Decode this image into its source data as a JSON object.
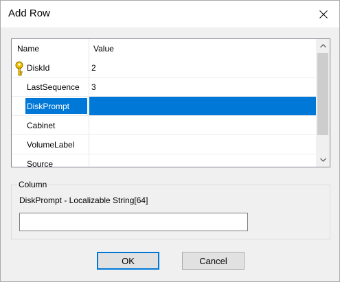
{
  "window": {
    "title": "Add Row"
  },
  "table": {
    "columns": [
      "Name",
      "Value"
    ],
    "rows": [
      {
        "name": "DiskId",
        "value": "2",
        "key": true
      },
      {
        "name": "LastSequence",
        "value": "3"
      },
      {
        "name": "DiskPrompt",
        "value": "",
        "selected": true
      },
      {
        "name": "Cabinet",
        "value": ""
      },
      {
        "name": "VolumeLabel",
        "value": ""
      },
      {
        "name": "Source",
        "value": ""
      }
    ]
  },
  "column_group": {
    "label": "Column",
    "description": "DiskPrompt - Localizable String[64]",
    "input_value": ""
  },
  "buttons": {
    "ok": "OK",
    "cancel": "Cancel"
  },
  "colors": {
    "selection": "#0078d7",
    "dialog_bg": "#f0f0f0"
  },
  "icons": {
    "close": "close-icon",
    "key": "key-icon",
    "scroll_up": "chevron-up-icon",
    "scroll_down": "chevron-down-icon"
  }
}
